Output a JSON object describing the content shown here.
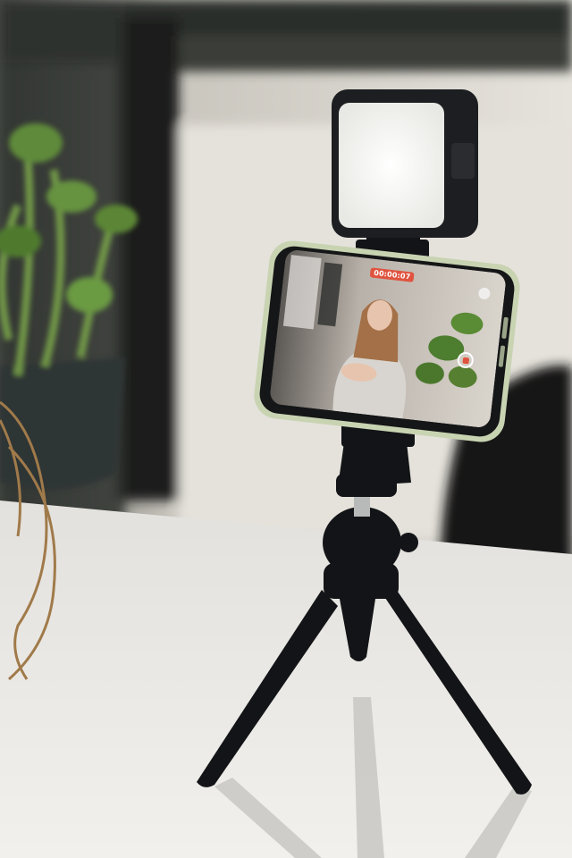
{
  "scene": {
    "subject": "smartphone-on-mini-tripod",
    "colors": {
      "wall": "#d9d6cf",
      "table": "#ece9e5",
      "tripod": "#121417",
      "phone_frame": "#c8d3b2",
      "light_panel": "#f7f7f4",
      "plant_green": "#5f8a3a"
    },
    "phone_screen": {
      "rec_timer": "00:00:07",
      "record_icon": "record-icon",
      "flip_icon": "camera-flip-icon"
    }
  }
}
